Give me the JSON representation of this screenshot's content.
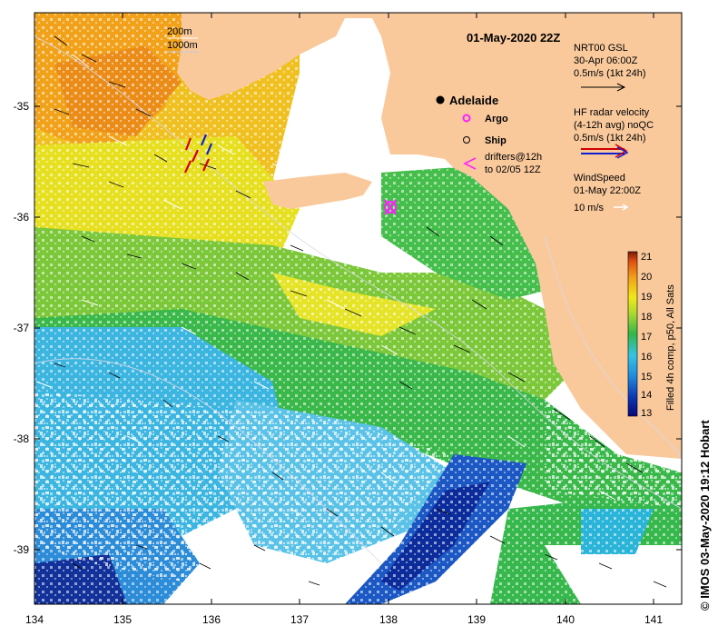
{
  "map": {
    "title": "01-May-2020 22Z",
    "credit": "© IMOS 03-May-2020 19:12 Hobart",
    "x_ticks": [
      "134",
      "135",
      "136",
      "137",
      "138",
      "139",
      "140",
      "141"
    ],
    "y_ticks": [
      "-35",
      "-36",
      "-37",
      "-38",
      "-39"
    ],
    "lon_range": [
      134,
      141.3
    ],
    "lat_range": [
      -39.5,
      -34.2
    ],
    "isobaths": {
      "label_200": "200m",
      "label_1000": "1000m"
    },
    "place": {
      "name": "Adelaide",
      "lon": 138.6,
      "lat": -34.93
    },
    "legend": {
      "argo": "Argo",
      "ship": "Ship",
      "drifters_line1": "drifters@12h",
      "drifters_line2": "to 02/05 12Z",
      "nrt_title": "NRT00 GSL",
      "nrt_date": "30-Apr 06:00Z",
      "nrt_scale": "0.5m/s (1kt 24h)",
      "hf_title": "HF radar velocity",
      "hf_sub": "(4-12h avg) noQC",
      "hf_scale": "0.5m/s (1kt 24h)",
      "wind_title": "WindSpeed",
      "wind_date": "01-May 22:00Z",
      "wind_scale": "10 m/s"
    },
    "colorbar": {
      "label": "Filled 4h comp, p50, All Sats",
      "ticks": [
        "21",
        "20",
        "19",
        "18",
        "17",
        "16",
        "15",
        "14",
        "13"
      ],
      "min": 13,
      "max": 21
    },
    "colors": {
      "land": "#f9c99c",
      "warm": "#f1a020",
      "hot": "#e86a10",
      "yellow": "#e8e020",
      "green": "#2fb84a",
      "cyan": "#3ab8e0",
      "blue": "#1a50c0",
      "navy": "#0a2890",
      "argo": "#ff20ff"
    }
  }
}
